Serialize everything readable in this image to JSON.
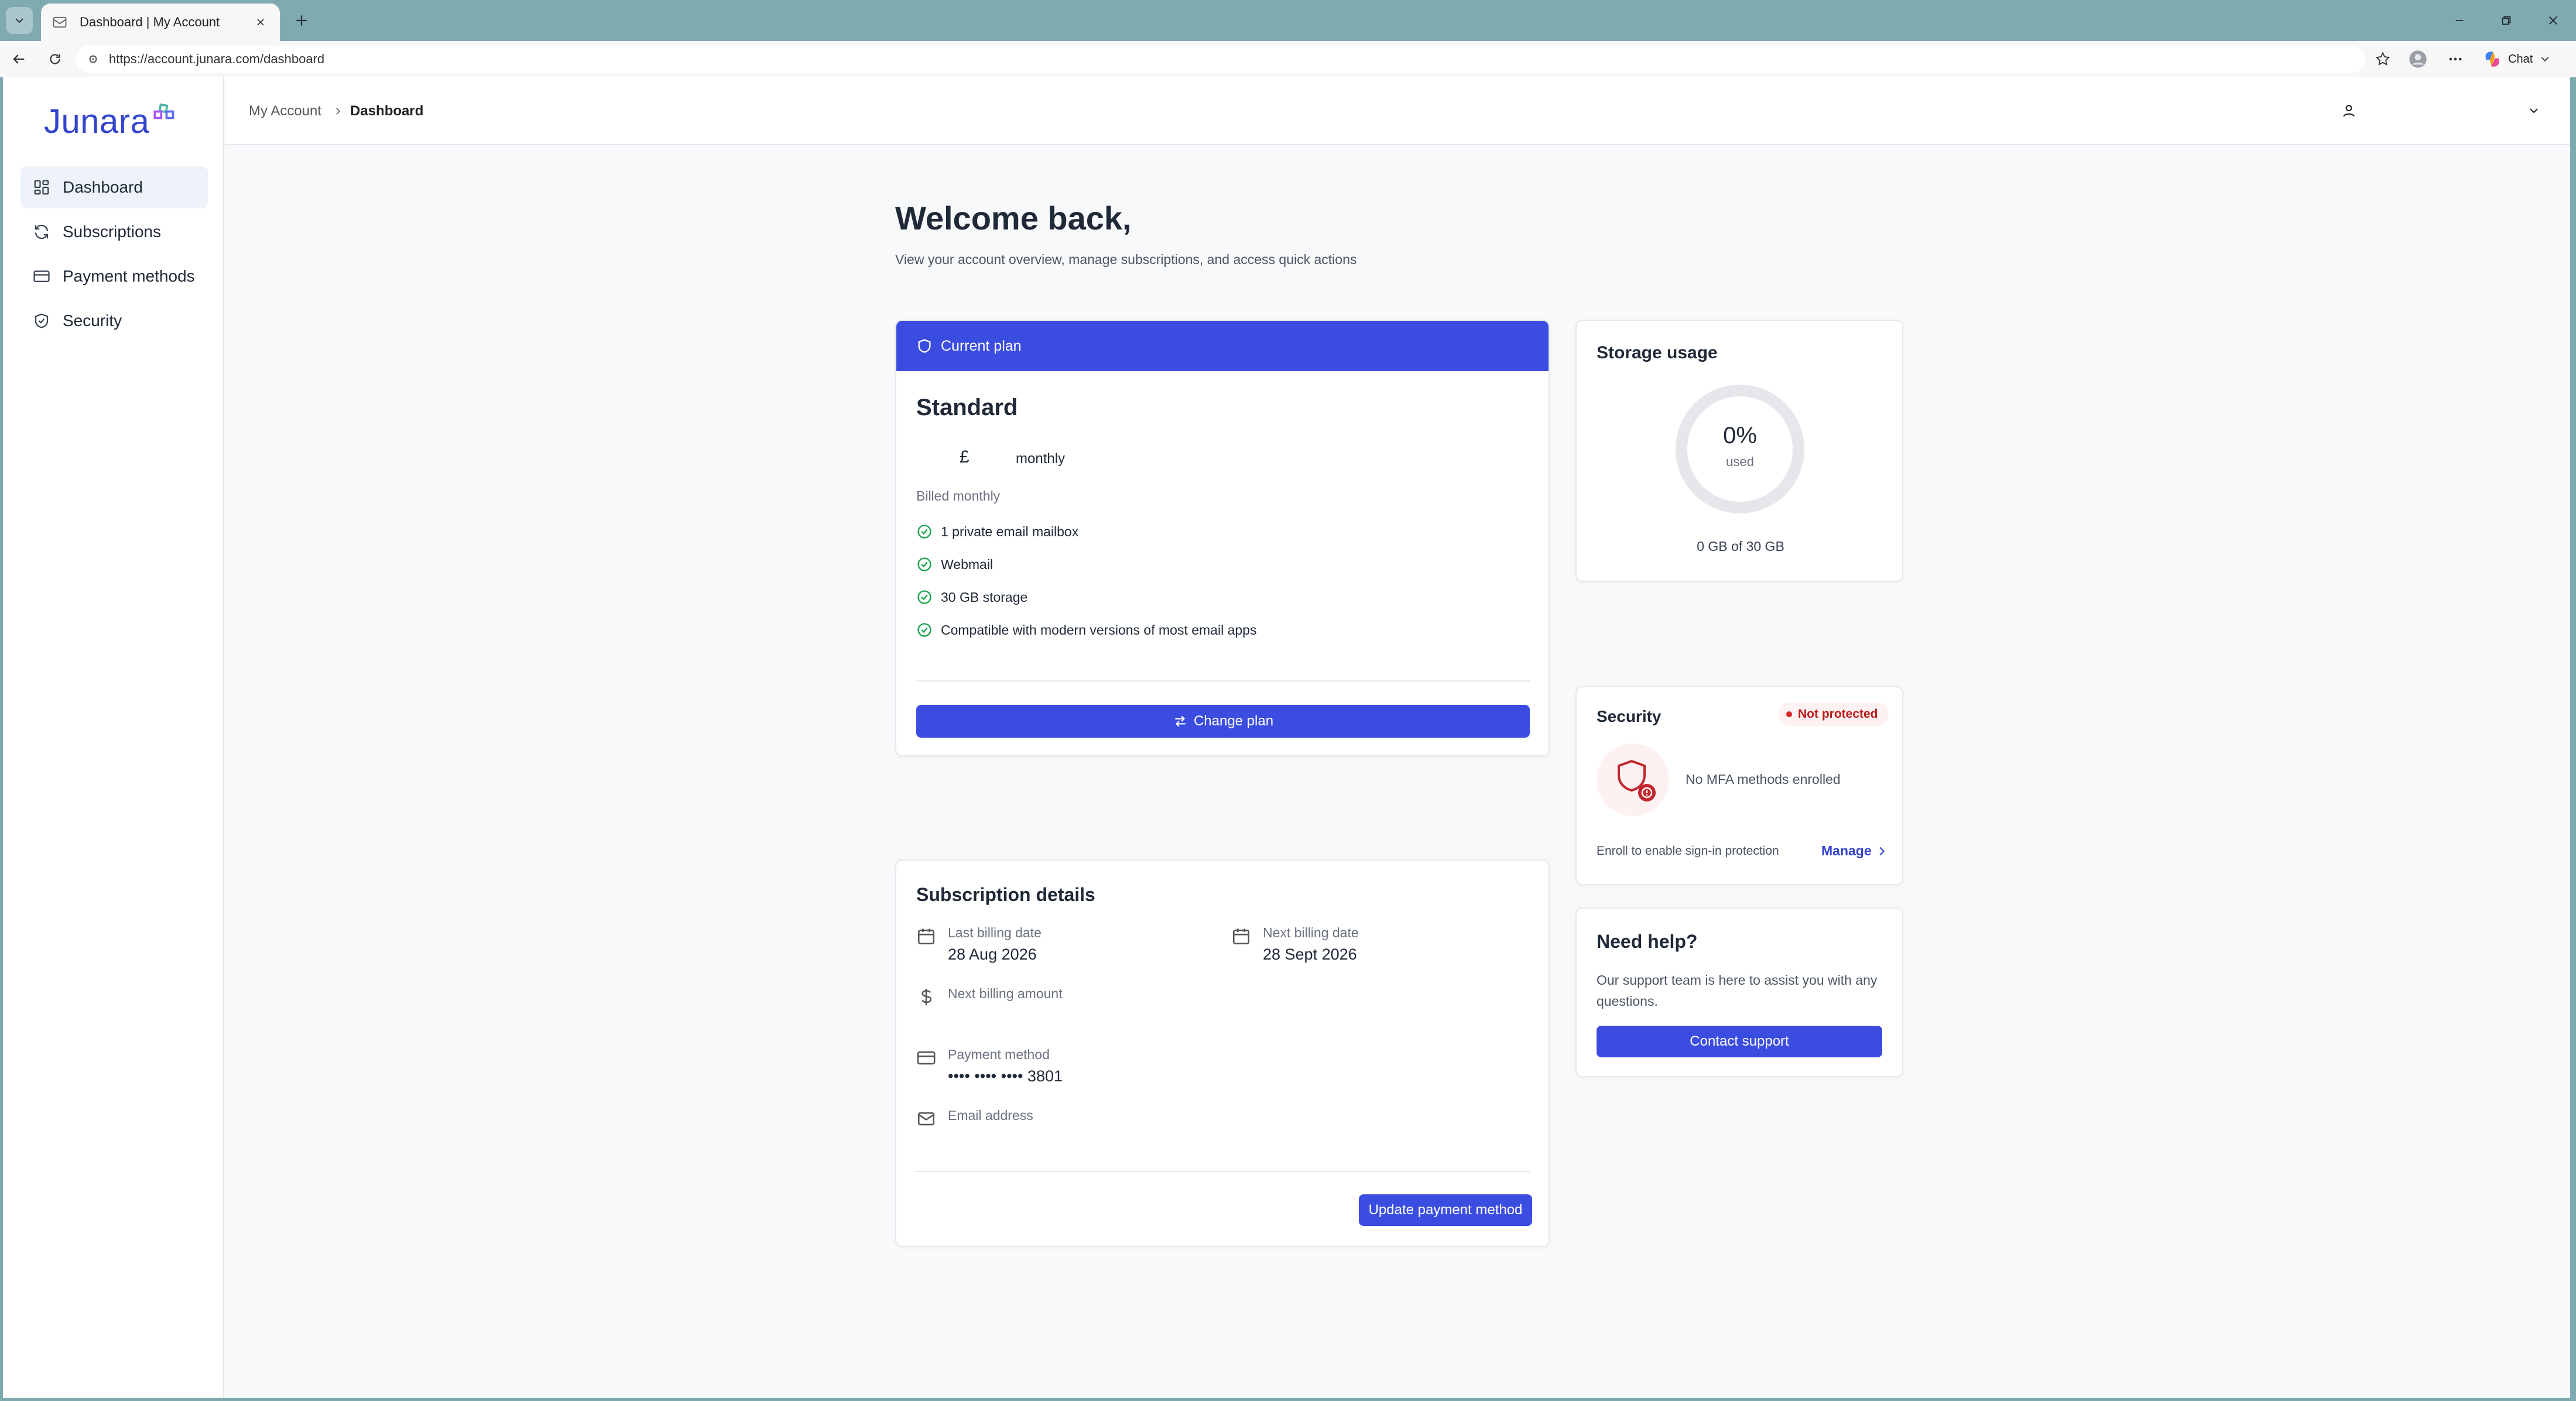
{
  "browser": {
    "tab_title": "Dashboard | My Account",
    "url": "https://account.junara.com/dashboard",
    "chat_label": "Chat"
  },
  "sidebar": {
    "logo": "Junara",
    "items": [
      {
        "label": "Dashboard",
        "icon": "dashboard-icon",
        "active": true
      },
      {
        "label": "Subscriptions",
        "icon": "refresh-icon",
        "active": false
      },
      {
        "label": "Payment methods",
        "icon": "credit-card-icon",
        "active": false
      },
      {
        "label": "Security",
        "icon": "shield-check-icon",
        "active": false
      }
    ]
  },
  "header": {
    "breadcrumb": [
      "My Account",
      "Dashboard"
    ]
  },
  "main": {
    "title": "Welcome back,",
    "subtitle": "View your account overview, manage subscriptions, and access quick actions"
  },
  "plan": {
    "header_label": "Current plan",
    "name": "Standard",
    "currency": "£",
    "period": "monthly",
    "billed": "Billed monthly",
    "features": [
      "1 private email mailbox",
      "Webmail",
      "30 GB storage",
      "Compatible with modern versions of most email apps"
    ],
    "change_button": "Change plan"
  },
  "subscription": {
    "title": "Subscription details",
    "last_billing_label": "Last billing date",
    "last_billing_value": "28 Aug 2026",
    "next_billing_label": "Next billing date",
    "next_billing_value": "28 Sept 2026",
    "next_amount_label": "Next billing amount",
    "payment_method_label": "Payment method",
    "payment_method_value": "•••• •••• •••• 3801",
    "email_label": "Email address",
    "update_button": "Update payment method"
  },
  "storage": {
    "title": "Storage usage",
    "percent_label": "0%",
    "used_fraction": 0,
    "used_label": "used",
    "caption": "0 GB of 30 GB"
  },
  "security": {
    "title": "Security",
    "status": "Not protected",
    "mfa_text": "No MFA methods enrolled",
    "enroll_text": "Enroll to enable sign-in protection",
    "manage_link": "Manage"
  },
  "help": {
    "title": "Need help?",
    "text": "Our support team is here to assist you with any questions.",
    "button": "Contact support"
  },
  "colors": {
    "accent": "#3b4de0",
    "danger": "#d62828",
    "success": "#16a34a"
  }
}
